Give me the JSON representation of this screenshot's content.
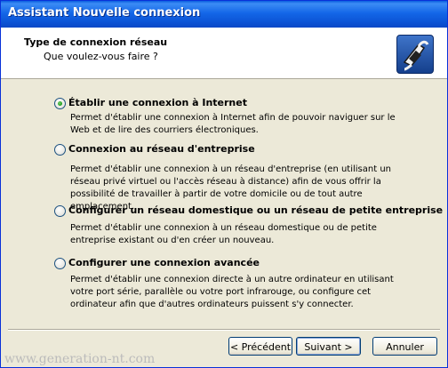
{
  "window": {
    "title": "Assistant Nouvelle connexion"
  },
  "header": {
    "title": "Type de connexion réseau",
    "subtitle": "Que voulez-vous faire ?",
    "icon": "network-connection-icon"
  },
  "options": [
    {
      "label": "Établir une connexion à Internet",
      "selected": true,
      "description": "Permet d'établir une connexion à Internet afin de pouvoir naviguer sur le Web et de lire des courriers électroniques."
    },
    {
      "label": "Connexion au réseau d'entreprise",
      "selected": false,
      "description": "Permet d'établir une connexion à un réseau d'entreprise (en utilisant un réseau privé virtuel ou l'accès réseau à distance) afin de vous offrir la possibilité de travailler à partir de votre domicile ou de tout autre emplacement."
    },
    {
      "label": "Configurer un réseau domestique ou un réseau de petite entreprise",
      "selected": false,
      "description": "Permet d'établir une connexion à un réseau domestique ou de petite entreprise existant ou d'en créer un nouveau."
    },
    {
      "label": "Configurer une connexion avancée",
      "selected": false,
      "description": "Permet d'établir une connexion directe à un autre ordinateur en utilisant votre port série, parallèle ou votre port infrarouge, ou configure cet ordinateur afin que d'autres ordinateurs puissent s'y connecter."
    }
  ],
  "buttons": {
    "back": "< Précédent",
    "next": "Suivant >",
    "cancel": "Annuler"
  },
  "watermark": "www.generation-nt.com",
  "colors": {
    "titlebar": "#0a5ee0",
    "dialog_bg": "#ece9d8",
    "radio_selected": "#21a121"
  }
}
